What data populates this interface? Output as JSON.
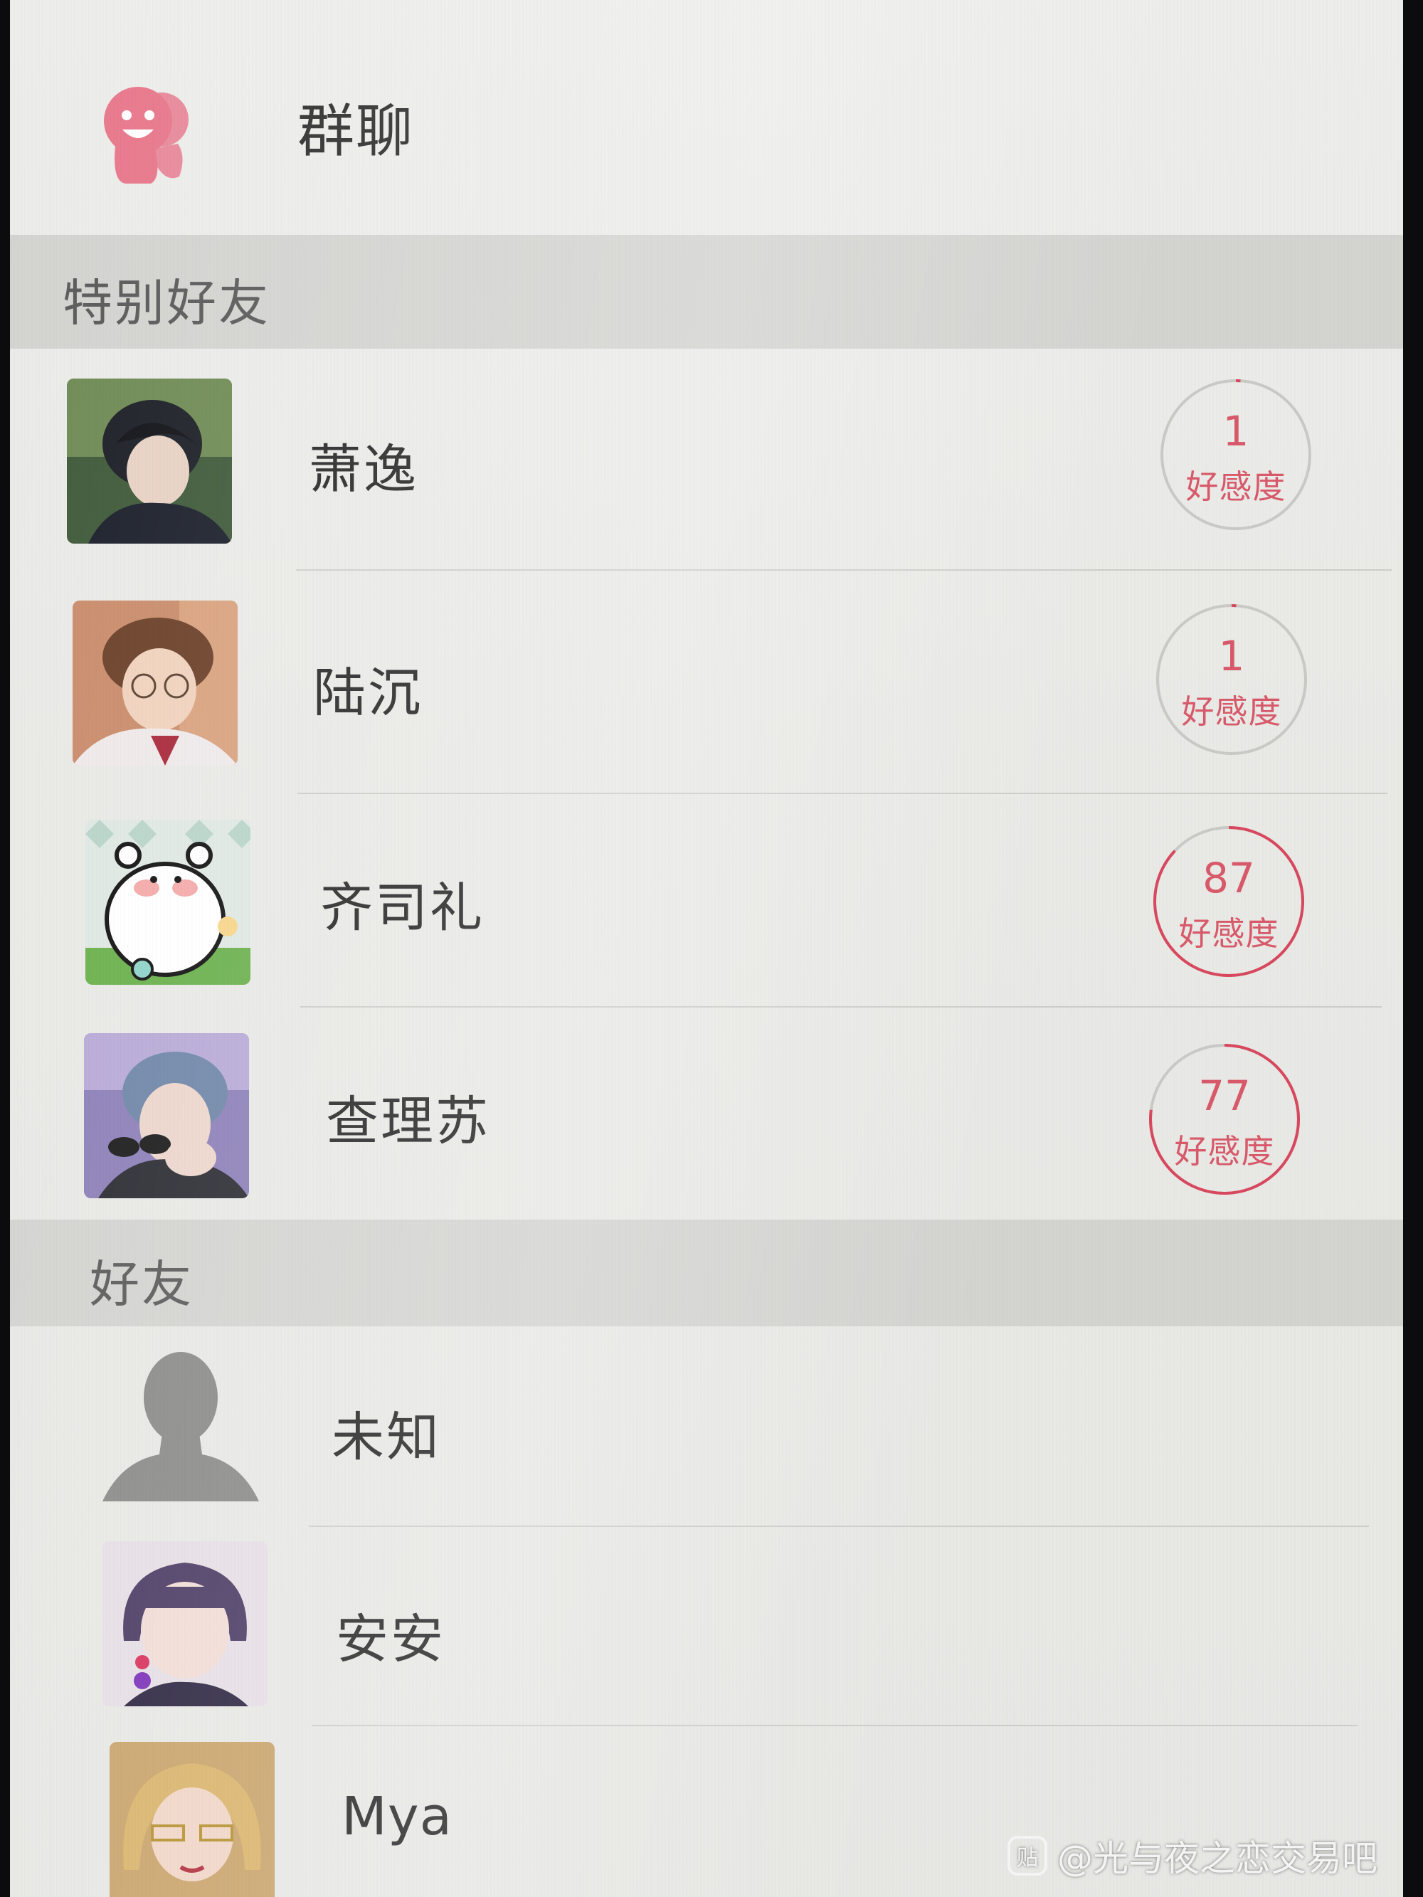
{
  "group_chat": {
    "label": "群聊",
    "icon": "group-chat-icon",
    "accent": "#e8788c"
  },
  "sections": [
    {
      "title": "特别好友",
      "contacts": [
        {
          "name": "萧逸",
          "affinity": "1",
          "affinity_label": "好感度",
          "affinity_fraction": 0.01
        },
        {
          "name": "陆沉",
          "affinity": "1",
          "affinity_label": "好感度",
          "affinity_fraction": 0.01
        },
        {
          "name": "齐司礼",
          "affinity": "87",
          "affinity_label": "好感度",
          "affinity_fraction": 0.87
        },
        {
          "name": "查理苏",
          "affinity": "77",
          "affinity_label": "好感度",
          "affinity_fraction": 0.77
        }
      ]
    },
    {
      "title": "好友",
      "contacts": [
        {
          "name": "未知"
        },
        {
          "name": "安安"
        },
        {
          "name": "Mya"
        }
      ]
    }
  ],
  "colors": {
    "affinity_ring": "#d8485e",
    "affinity_track": "#c9c9c6",
    "affinity_text": "#d85a6a"
  },
  "watermark": {
    "text": "@光与夜之恋交易吧",
    "icon_glyph": "贴"
  }
}
